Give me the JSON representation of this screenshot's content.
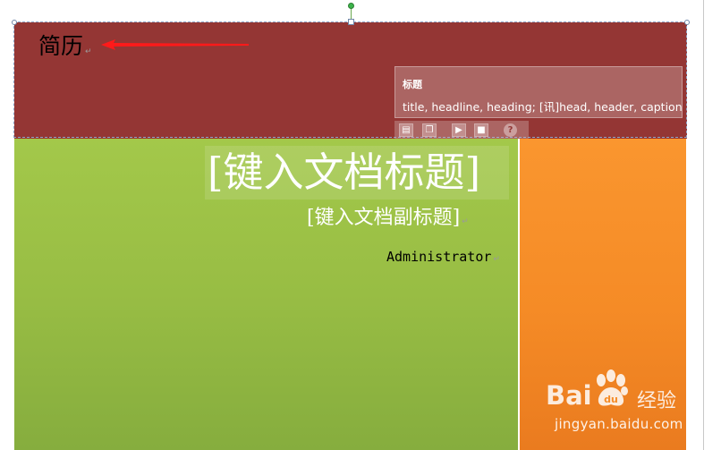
{
  "header": {
    "title": "简历",
    "para_mark": "↵"
  },
  "tooltip": {
    "heading": "标题",
    "body": "title, headline, heading; [讯]head, header, caption",
    "help_glyph": "?",
    "toolbar_icons": [
      "paste-icon",
      "copy-icon",
      "play-icon",
      "stop-icon",
      "help-icon"
    ]
  },
  "cover": {
    "title_placeholder": "[键入文档标题]",
    "subtitle_placeholder": "[键入文档副标题]",
    "author": "Administrator",
    "para_mark": "↵"
  },
  "watermark": {
    "brand": "Bai",
    "brand_suffix": "经验",
    "url": "jingyan.baidu.com"
  },
  "colors": {
    "header_band": "#943634",
    "green_panel": "#9bbb59",
    "orange_panel": "#f79646",
    "arrow": "#ff0000"
  }
}
